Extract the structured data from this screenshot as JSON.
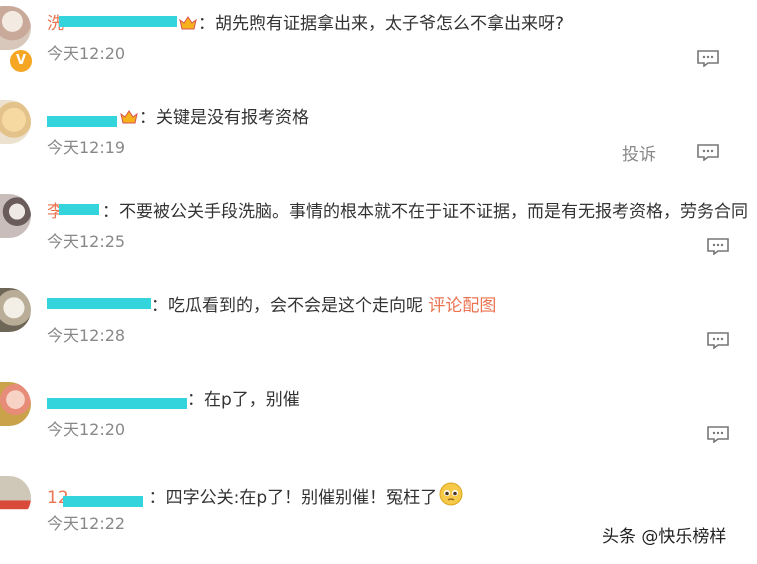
{
  "comments": [
    {
      "name": "洗",
      "text": "胡先煦有证据拿出来，太子爷怎么不拿出来呀?",
      "time": "今天12:20"
    },
    {
      "name": "",
      "text": "关键是没有报考资格",
      "time": "今天12:19",
      "report": "投诉"
    },
    {
      "name": "李",
      "text": "不要被公关手段洗脑。事情的根本就不在于证不证据，而是有无报考资格，劳务合同",
      "time": "今天12:25"
    },
    {
      "name": "",
      "text": "吃瓜看到的，会不会是这个走向呢",
      "link": "评论配图",
      "time": "今天12:28"
    },
    {
      "name": "",
      "text": "在p了，别催",
      "time": "今天12:20"
    },
    {
      "name": "12",
      "text": "四字公关:在p了！别催别催！冤枉了",
      "time": "今天12:22"
    }
  ],
  "colon": "：",
  "watermark": "头条 @快乐榜样",
  "icons": [
    "reply-icon",
    "crown-badge-icon",
    "pleading-face-emoji",
    "verified-v-icon"
  ],
  "colors": {
    "name": "#eb7350",
    "text": "#333333",
    "time": "#888888",
    "link": "#eb7350"
  }
}
